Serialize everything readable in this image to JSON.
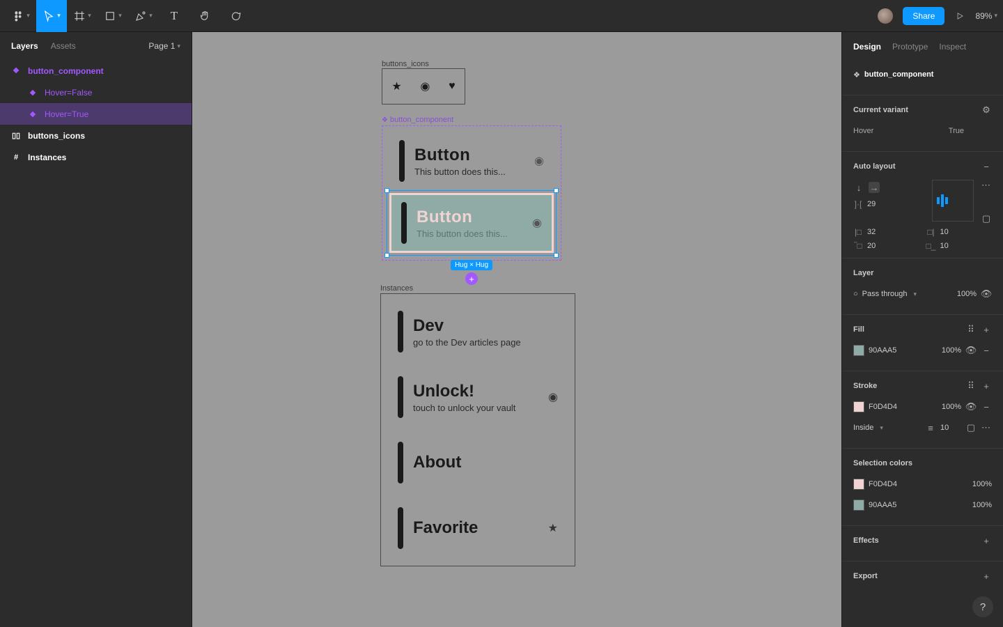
{
  "toolbar": {
    "share": "Share",
    "zoom": "89%"
  },
  "leftPanel": {
    "tabs": {
      "layers": "Layers",
      "assets": "Assets"
    },
    "page": "Page 1",
    "layers": {
      "component": "button_component",
      "hoverFalse": "Hover=False",
      "hoverTrue": "Hover=True",
      "iconsFrame": "buttons_icons",
      "instances": "Instances"
    }
  },
  "canvas": {
    "iconsLabel": "buttons_icons",
    "compLabel": "button_component",
    "instancesLabel": "Instances",
    "defaultButton": {
      "title": "Button",
      "sub": "This button does this..."
    },
    "hoverButton": {
      "title": "Button",
      "sub": "This button does this..."
    },
    "sizeTag": "Hug × Hug",
    "instances": [
      {
        "title": "Dev",
        "sub": "go to the Dev articles page",
        "icon": ""
      },
      {
        "title": "Unlock!",
        "sub": "touch to unlock your vault",
        "icon": "fingerprint"
      },
      {
        "title": "About",
        "sub": "",
        "icon": ""
      },
      {
        "title": "Favorite",
        "sub": "",
        "icon": "star"
      }
    ]
  },
  "rightPanel": {
    "tabs": {
      "design": "Design",
      "prototype": "Prototype",
      "inspect": "Inspect"
    },
    "parentComponent": "button_component",
    "currentVariant": {
      "label": "Current variant",
      "prop": "Hover",
      "value": "True"
    },
    "autoLayout": {
      "label": "Auto layout",
      "gap": "29",
      "padLeft": "32",
      "padRight": "10",
      "padTop": "20",
      "padBottom": "10"
    },
    "layer": {
      "label": "Layer",
      "blend": "Pass through",
      "opacity": "100%"
    },
    "fill": {
      "label": "Fill",
      "hex": "90AAA5",
      "opacity": "100%"
    },
    "stroke": {
      "label": "Stroke",
      "hex": "F0D4D4",
      "opacity": "100%",
      "align": "Inside",
      "weight": "10"
    },
    "selectionColors": {
      "label": "Selection colors",
      "c1": {
        "hex": "F0D4D4",
        "opacity": "100%"
      },
      "c2": {
        "hex": "90AAA5",
        "opacity": "100%"
      }
    },
    "effects": "Effects",
    "export": "Export"
  }
}
